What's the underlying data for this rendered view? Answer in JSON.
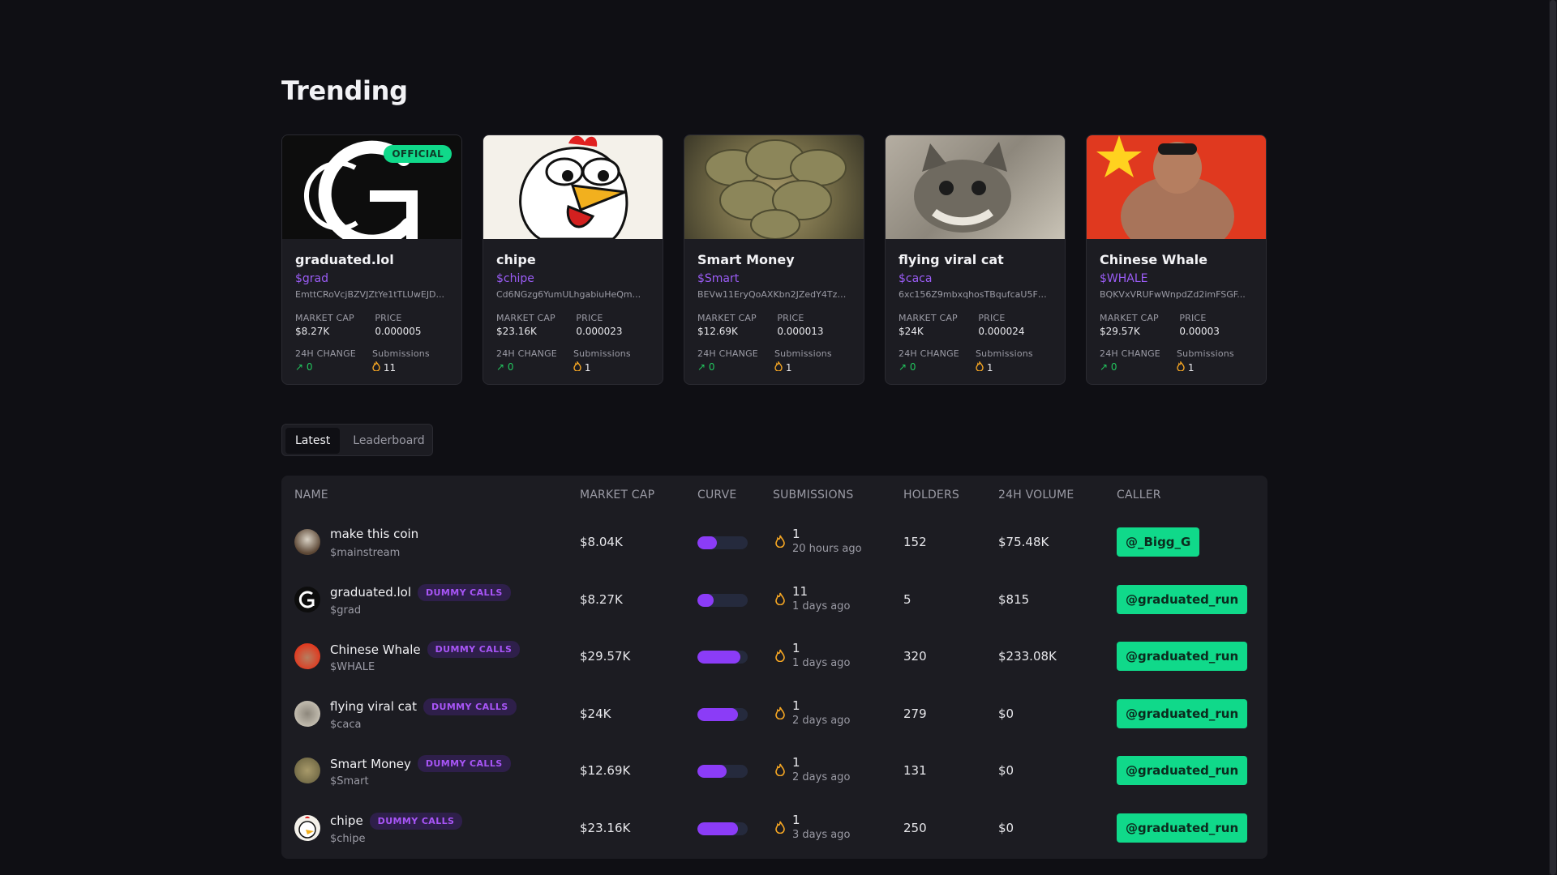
{
  "page": {
    "title": "Trending"
  },
  "trending": [
    {
      "name": "graduated.lol",
      "ticker": "$grad",
      "address": "EmttCRoVcjBZVJZtYe1tTLUwEJD...",
      "market_cap_label": "MARKET CAP",
      "market_cap": "$8.27K",
      "price_label": "PRICE",
      "price": "0.000005",
      "change_label": "24H CHANGE",
      "change": "0",
      "subs_label": "Submissions",
      "submissions": "11",
      "badge": "OFFICIAL"
    },
    {
      "name": "chipe",
      "ticker": "$chipe",
      "address": "Cd6NGzg6YumULhgabiuHeQm...",
      "market_cap_label": "MARKET CAP",
      "market_cap": "$23.16K",
      "price_label": "PRICE",
      "price": "0.000023",
      "change_label": "24H CHANGE",
      "change": "0",
      "subs_label": "Submissions",
      "submissions": "1"
    },
    {
      "name": "Smart Money",
      "ticker": "$Smart",
      "address": "BEVw11EryQoAXKbn2JZedY4Tz7...",
      "market_cap_label": "MARKET CAP",
      "market_cap": "$12.69K",
      "price_label": "PRICE",
      "price": "0.000013",
      "change_label": "24H CHANGE",
      "change": "0",
      "subs_label": "Submissions",
      "submissions": "1"
    },
    {
      "name": "flying viral cat",
      "ticker": "$caca",
      "address": "6xc156Z9mbxqhosTBqufcaU5FR...",
      "market_cap_label": "MARKET CAP",
      "market_cap": "$24K",
      "price_label": "PRICE",
      "price": "0.000024",
      "change_label": "24H CHANGE",
      "change": "0",
      "subs_label": "Submissions",
      "submissions": "1"
    },
    {
      "name": "Chinese Whale",
      "ticker": "$WHALE",
      "address": "BQKVxVRUFwWnpdZd2imFSGF...",
      "market_cap_label": "MARKET CAP",
      "market_cap": "$29.57K",
      "price_label": "PRICE",
      "price": "0.00003",
      "change_label": "24H CHANGE",
      "change": "0",
      "subs_label": "Submissions",
      "submissions": "1"
    }
  ],
  "tabs": {
    "latest": "Latest",
    "leaderboard": "Leaderboard"
  },
  "table": {
    "headers": {
      "name": "NAME",
      "market_cap": "MARKET CAP",
      "curve": "CURVE",
      "submissions": "SUBMISSIONS",
      "holders": "HOLDERS",
      "volume": "24H VOLUME",
      "caller": "CALLER"
    },
    "rows": [
      {
        "name": "make this coin",
        "ticker": "$mainstream",
        "badge": "",
        "market_cap": "$8.04K",
        "curve_pct": 38,
        "submissions": "1",
        "time": "20 hours ago",
        "holders": "152",
        "volume": "$75.48K",
        "caller": "@_Bigg_G"
      },
      {
        "name": "graduated.lol",
        "ticker": "$grad",
        "badge": "DUMMY CALLS",
        "market_cap": "$8.27K",
        "curve_pct": 33,
        "submissions": "11",
        "time": "1 days ago",
        "holders": "5",
        "volume": "$815",
        "caller": "@graduated_run"
      },
      {
        "name": "Chinese Whale",
        "ticker": "$WHALE",
        "badge": "DUMMY CALLS",
        "market_cap": "$29.57K",
        "curve_pct": 85,
        "submissions": "1",
        "time": "1 days ago",
        "holders": "320",
        "volume": "$233.08K",
        "caller": "@graduated_run"
      },
      {
        "name": "flying viral cat",
        "ticker": "$caca",
        "badge": "DUMMY CALLS",
        "market_cap": "$24K",
        "curve_pct": 80,
        "submissions": "1",
        "time": "2 days ago",
        "holders": "279",
        "volume": "$0",
        "caller": "@graduated_run"
      },
      {
        "name": "Smart Money",
        "ticker": "$Smart",
        "badge": "DUMMY CALLS",
        "market_cap": "$12.69K",
        "curve_pct": 58,
        "submissions": "1",
        "time": "2 days ago",
        "holders": "131",
        "volume": "$0",
        "caller": "@graduated_run"
      },
      {
        "name": "chipe",
        "ticker": "$chipe",
        "badge": "DUMMY CALLS",
        "market_cap": "$23.16K",
        "curve_pct": 80,
        "submissions": "1",
        "time": "3 days ago",
        "holders": "250",
        "volume": "$0",
        "caller": "@graduated_run"
      }
    ]
  },
  "colors": {
    "accent_green": "#10d98a",
    "accent_purple": "#9b5cf6",
    "background": "#0f0f14",
    "card": "#1c1c22"
  }
}
